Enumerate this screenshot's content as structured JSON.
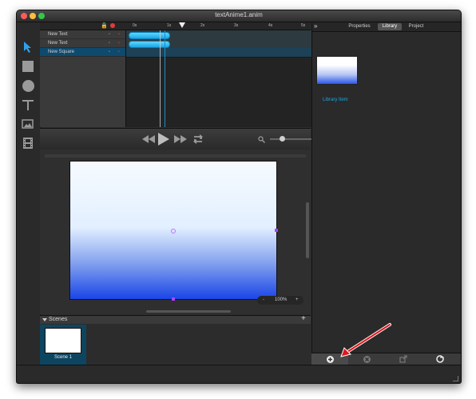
{
  "window": {
    "title": "textAnime1.anim"
  },
  "layers": [
    {
      "label": "New Text"
    },
    {
      "label": "New Text"
    },
    {
      "label": "New Square"
    }
  ],
  "timeline": {
    "ticks": [
      "0s",
      "1s",
      "2s",
      "3s",
      "4s",
      "5s"
    ]
  },
  "stage": {
    "zoom_label": "100%",
    "zoom_minus": "-",
    "zoom_plus": "+"
  },
  "scenes": {
    "header_label": "Scenes",
    "items": [
      {
        "label": "Scene 1"
      }
    ]
  },
  "right_panel": {
    "tabs": [
      "Properties",
      "Library",
      "Project"
    ],
    "active_tab": "Library",
    "library_item_label": "Library Item"
  },
  "colors": {
    "accent": "#1aa6e6",
    "selection": "#0e4a6e",
    "annotation": "#e0161c"
  }
}
